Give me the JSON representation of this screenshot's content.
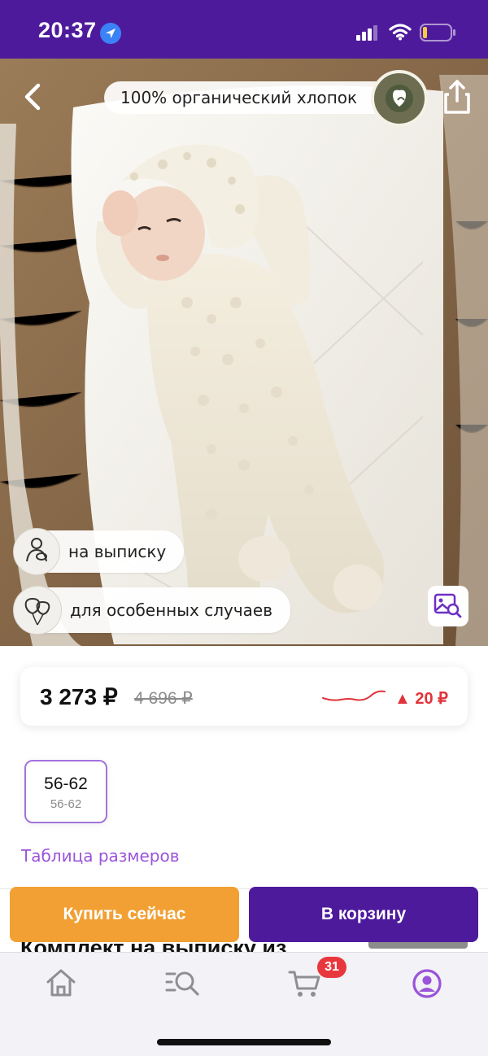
{
  "status_bar": {
    "time": "20:37"
  },
  "product_gallery": {
    "top_badge": "100% органический хлопок",
    "seal_text": "GLOBAL ORGANIC TEXTILE STANDARD",
    "tags": [
      {
        "label": "на выписку",
        "icon": "mother-baby-icon"
      },
      {
        "label": "для особенных случаев",
        "icon": "balloons-icon"
      }
    ]
  },
  "price": {
    "current": "3 273 ₽",
    "old": "4 696 ₽",
    "delta": "▲ 20 ₽",
    "trend_color": "#e0333a"
  },
  "size": {
    "selected": "56-62",
    "sub": "56-62",
    "table_link": "Таблица размеров"
  },
  "peek": {
    "title": "Комплект на выписку из"
  },
  "actions": {
    "buy_now": "Купить сейчас",
    "add_to_cart": "В корзину"
  },
  "tab_bar": {
    "cart_count": "31",
    "active_tab": "profile",
    "accent_color": "#9a54d9"
  }
}
